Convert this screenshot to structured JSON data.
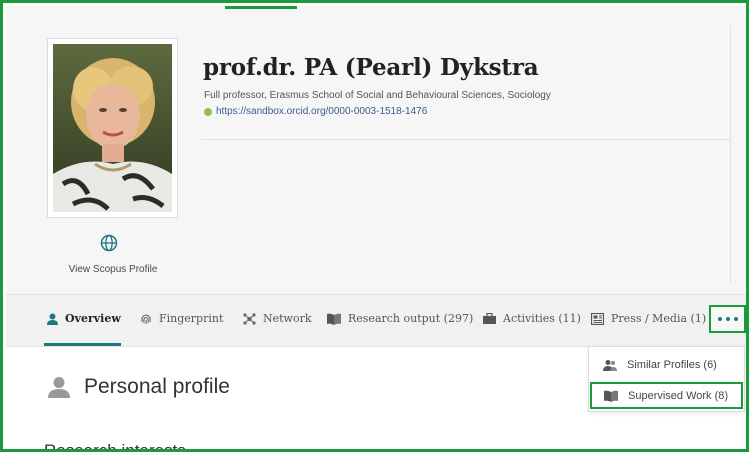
{
  "profile": {
    "name": "prof.dr. PA (Pearl) Dykstra",
    "role": "Full professor, Erasmus School of Social and Behavioural Sciences, Sociology",
    "orcid_url": "https://sandbox.orcid.org/0000-0003-1518-1476",
    "scopus_link": "View Scopus Profile"
  },
  "tabs": [
    {
      "label": "Overview",
      "icon": "person-icon",
      "active": true
    },
    {
      "label": "Fingerprint",
      "icon": "fingerprint-icon",
      "active": false
    },
    {
      "label": "Network",
      "icon": "network-icon",
      "active": false
    },
    {
      "label": "Research output (297)",
      "icon": "book-icon",
      "active": false
    },
    {
      "label": "Activities (11)",
      "icon": "briefcase-icon",
      "active": false
    },
    {
      "label": "Press / Media (1)",
      "icon": "newspaper-icon",
      "active": false
    }
  ],
  "more_menu": {
    "icon": "more-dots-icon",
    "items": [
      {
        "label": "Similar Profiles (6)",
        "icon": "similar-profiles-icon"
      },
      {
        "label": "Supervised Work (8)",
        "icon": "book-icon"
      }
    ]
  },
  "section": {
    "title": "Personal profile",
    "icon": "person-icon",
    "next_heading": "Research interests"
  },
  "colors": {
    "highlight_border": "#1a9a3a",
    "accent_teal": "#1a7a80",
    "header_bg": "#f6f6f6",
    "orcid_green": "#8bc34a"
  }
}
